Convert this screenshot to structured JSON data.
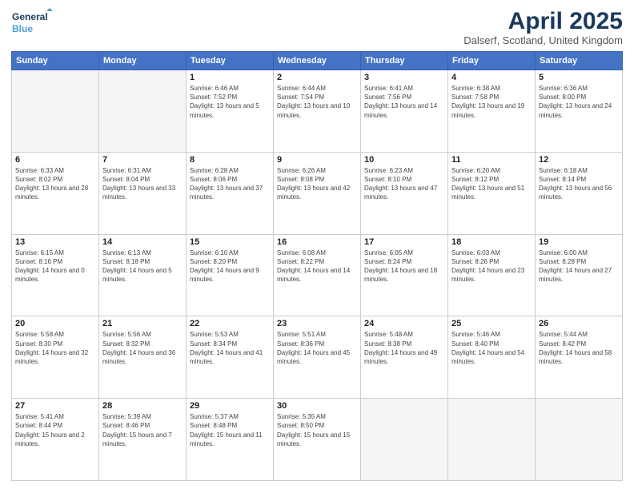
{
  "logo": {
    "line1": "General",
    "line2": "Blue"
  },
  "title": "April 2025",
  "subtitle": "Dalserf, Scotland, United Kingdom",
  "weekdays": [
    "Sunday",
    "Monday",
    "Tuesday",
    "Wednesday",
    "Thursday",
    "Friday",
    "Saturday"
  ],
  "weeks": [
    [
      {
        "day": "",
        "info": ""
      },
      {
        "day": "",
        "info": ""
      },
      {
        "day": "1",
        "info": "Sunrise: 6:46 AM\nSunset: 7:52 PM\nDaylight: 13 hours and 5 minutes."
      },
      {
        "day": "2",
        "info": "Sunrise: 6:44 AM\nSunset: 7:54 PM\nDaylight: 13 hours and 10 minutes."
      },
      {
        "day": "3",
        "info": "Sunrise: 6:41 AM\nSunset: 7:56 PM\nDaylight: 13 hours and 14 minutes."
      },
      {
        "day": "4",
        "info": "Sunrise: 6:38 AM\nSunset: 7:58 PM\nDaylight: 13 hours and 19 minutes."
      },
      {
        "day": "5",
        "info": "Sunrise: 6:36 AM\nSunset: 8:00 PM\nDaylight: 13 hours and 24 minutes."
      }
    ],
    [
      {
        "day": "6",
        "info": "Sunrise: 6:33 AM\nSunset: 8:02 PM\nDaylight: 13 hours and 28 minutes."
      },
      {
        "day": "7",
        "info": "Sunrise: 6:31 AM\nSunset: 8:04 PM\nDaylight: 13 hours and 33 minutes."
      },
      {
        "day": "8",
        "info": "Sunrise: 6:28 AM\nSunset: 8:06 PM\nDaylight: 13 hours and 37 minutes."
      },
      {
        "day": "9",
        "info": "Sunrise: 6:26 AM\nSunset: 8:08 PM\nDaylight: 13 hours and 42 minutes."
      },
      {
        "day": "10",
        "info": "Sunrise: 6:23 AM\nSunset: 8:10 PM\nDaylight: 13 hours and 47 minutes."
      },
      {
        "day": "11",
        "info": "Sunrise: 6:20 AM\nSunset: 8:12 PM\nDaylight: 13 hours and 51 minutes."
      },
      {
        "day": "12",
        "info": "Sunrise: 6:18 AM\nSunset: 8:14 PM\nDaylight: 13 hours and 56 minutes."
      }
    ],
    [
      {
        "day": "13",
        "info": "Sunrise: 6:15 AM\nSunset: 8:16 PM\nDaylight: 14 hours and 0 minutes."
      },
      {
        "day": "14",
        "info": "Sunrise: 6:13 AM\nSunset: 8:18 PM\nDaylight: 14 hours and 5 minutes."
      },
      {
        "day": "15",
        "info": "Sunrise: 6:10 AM\nSunset: 8:20 PM\nDaylight: 14 hours and 9 minutes."
      },
      {
        "day": "16",
        "info": "Sunrise: 6:08 AM\nSunset: 8:22 PM\nDaylight: 14 hours and 14 minutes."
      },
      {
        "day": "17",
        "info": "Sunrise: 6:05 AM\nSunset: 8:24 PM\nDaylight: 14 hours and 18 minutes."
      },
      {
        "day": "18",
        "info": "Sunrise: 6:03 AM\nSunset: 8:26 PM\nDaylight: 14 hours and 23 minutes."
      },
      {
        "day": "19",
        "info": "Sunrise: 6:00 AM\nSunset: 8:28 PM\nDaylight: 14 hours and 27 minutes."
      }
    ],
    [
      {
        "day": "20",
        "info": "Sunrise: 5:58 AM\nSunset: 8:30 PM\nDaylight: 14 hours and 32 minutes."
      },
      {
        "day": "21",
        "info": "Sunrise: 5:56 AM\nSunset: 8:32 PM\nDaylight: 14 hours and 36 minutes."
      },
      {
        "day": "22",
        "info": "Sunrise: 5:53 AM\nSunset: 8:34 PM\nDaylight: 14 hours and 41 minutes."
      },
      {
        "day": "23",
        "info": "Sunrise: 5:51 AM\nSunset: 8:36 PM\nDaylight: 14 hours and 45 minutes."
      },
      {
        "day": "24",
        "info": "Sunrise: 5:48 AM\nSunset: 8:38 PM\nDaylight: 14 hours and 49 minutes."
      },
      {
        "day": "25",
        "info": "Sunrise: 5:46 AM\nSunset: 8:40 PM\nDaylight: 14 hours and 54 minutes."
      },
      {
        "day": "26",
        "info": "Sunrise: 5:44 AM\nSunset: 8:42 PM\nDaylight: 14 hours and 58 minutes."
      }
    ],
    [
      {
        "day": "27",
        "info": "Sunrise: 5:41 AM\nSunset: 8:44 PM\nDaylight: 15 hours and 2 minutes."
      },
      {
        "day": "28",
        "info": "Sunrise: 5:39 AM\nSunset: 8:46 PM\nDaylight: 15 hours and 7 minutes."
      },
      {
        "day": "29",
        "info": "Sunrise: 5:37 AM\nSunset: 8:48 PM\nDaylight: 15 hours and 11 minutes."
      },
      {
        "day": "30",
        "info": "Sunrise: 5:35 AM\nSunset: 8:50 PM\nDaylight: 15 hours and 15 minutes."
      },
      {
        "day": "",
        "info": ""
      },
      {
        "day": "",
        "info": ""
      },
      {
        "day": "",
        "info": ""
      }
    ]
  ]
}
